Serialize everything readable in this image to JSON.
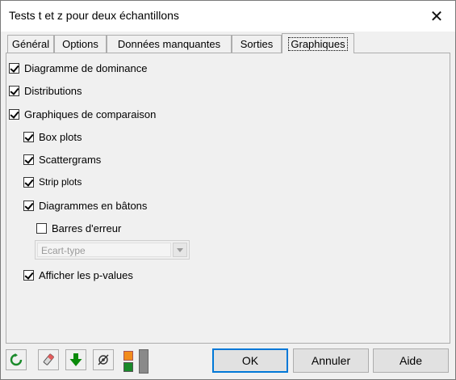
{
  "window": {
    "title": "Tests t et z pour deux échantillons",
    "close_glyph": "✕"
  },
  "tabs": [
    {
      "label": "Général",
      "active": false
    },
    {
      "label": "Options",
      "active": false
    },
    {
      "label": "Données manquantes",
      "active": false
    },
    {
      "label": "Sorties",
      "active": false
    },
    {
      "label": "Graphiques",
      "active": true
    }
  ],
  "options": {
    "dominance_plot": {
      "label": "Diagramme de dominance",
      "checked": true
    },
    "distributions": {
      "label": "Distributions",
      "checked": true
    },
    "comparison_charts": {
      "label": "Graphiques de comparaison",
      "checked": true
    },
    "box_plots": {
      "label": "Box plots",
      "checked": true
    },
    "scattergrams": {
      "label": "Scattergrams",
      "checked": true
    },
    "strip_plots": {
      "label": "Strip plots",
      "checked": true
    },
    "bar_charts": {
      "label": "Diagrammes en bâtons",
      "checked": true
    },
    "error_bars": {
      "label": "Barres d'erreur",
      "checked": false
    },
    "error_type": {
      "value": "Ecart-type",
      "enabled": false
    },
    "show_pvalues": {
      "label": "Afficher les p-values",
      "checked": true
    }
  },
  "toolbar": {
    "icons": [
      "reset-icon",
      "eraser-icon",
      "download-arrow-icon",
      "settings-icon",
      "color-toggle-icon"
    ],
    "ok_label": "OK",
    "cancel_label": "Annuler",
    "help_label": "Aide"
  },
  "colors": {
    "reset_green": "#1a8a2a",
    "arrow_green": "#0b8a0b",
    "orange": "#f28c1c",
    "default_border": "#0078d7"
  }
}
